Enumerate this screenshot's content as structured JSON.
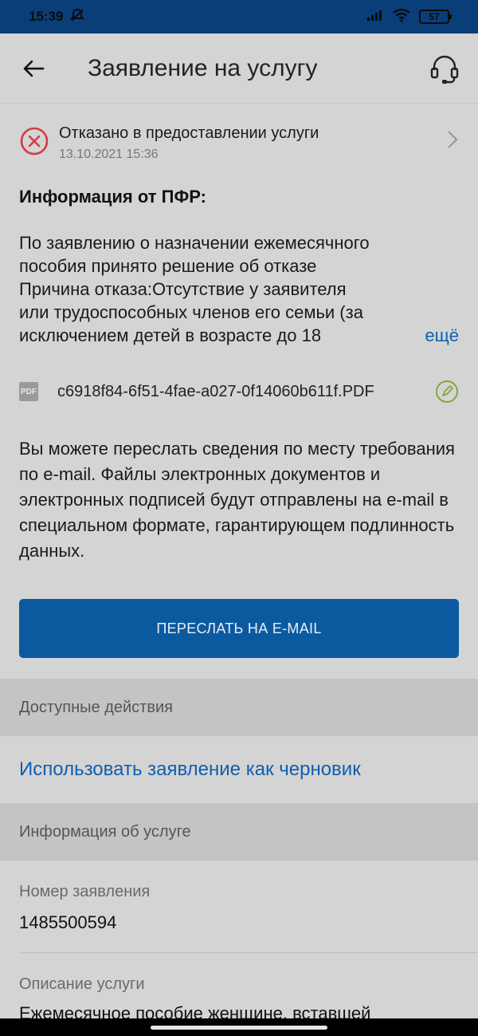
{
  "status_bar": {
    "time": "15:39",
    "battery": "57"
  },
  "app_bar": {
    "title": "Заявление на услугу"
  },
  "status": {
    "title": "Отказано в предоставлении услуги",
    "date": "13.10.2021 15:36",
    "color": "#d63a4a"
  },
  "info": {
    "heading": "Информация от ПФР:",
    "lines": [
      "По заявлению о назначении ежемесячного",
      "пособия принято решение об отказе",
      "Причина отказа:Отсутствие у заявителя",
      "или трудоспособных членов его семьи (за",
      "исключением детей в возрасте до 18"
    ],
    "more_label": "ещё"
  },
  "file": {
    "badge": "PDF",
    "name": "c6918f84-6f51-4fae-a027-0f14060b611f.PDF"
  },
  "email_info": "Вы можете переслать сведения по месту требования по e-mail. Файлы электронных документов и электронных подписей будут отправлены на e-mail в специальном формате, гарантирующем подлинность данных.",
  "send_button": "ПЕРЕСЛАТЬ НА E-MAIL",
  "actions": {
    "heading": "Доступные действия",
    "items": [
      "Использовать заявление как черновик"
    ]
  },
  "service_info": {
    "heading": "Информация об услуге",
    "fields": [
      {
        "label": "Номер заявления",
        "value": "1485500594"
      },
      {
        "label": "Описание услуги",
        "value": "Ежемесячное пособие женщине, вставшей"
      }
    ]
  },
  "colors": {
    "accent": "#0b5aa0",
    "link": "#0f5fae",
    "status_bar": "#0a3e78",
    "sign_icon": "#7fa83a"
  }
}
